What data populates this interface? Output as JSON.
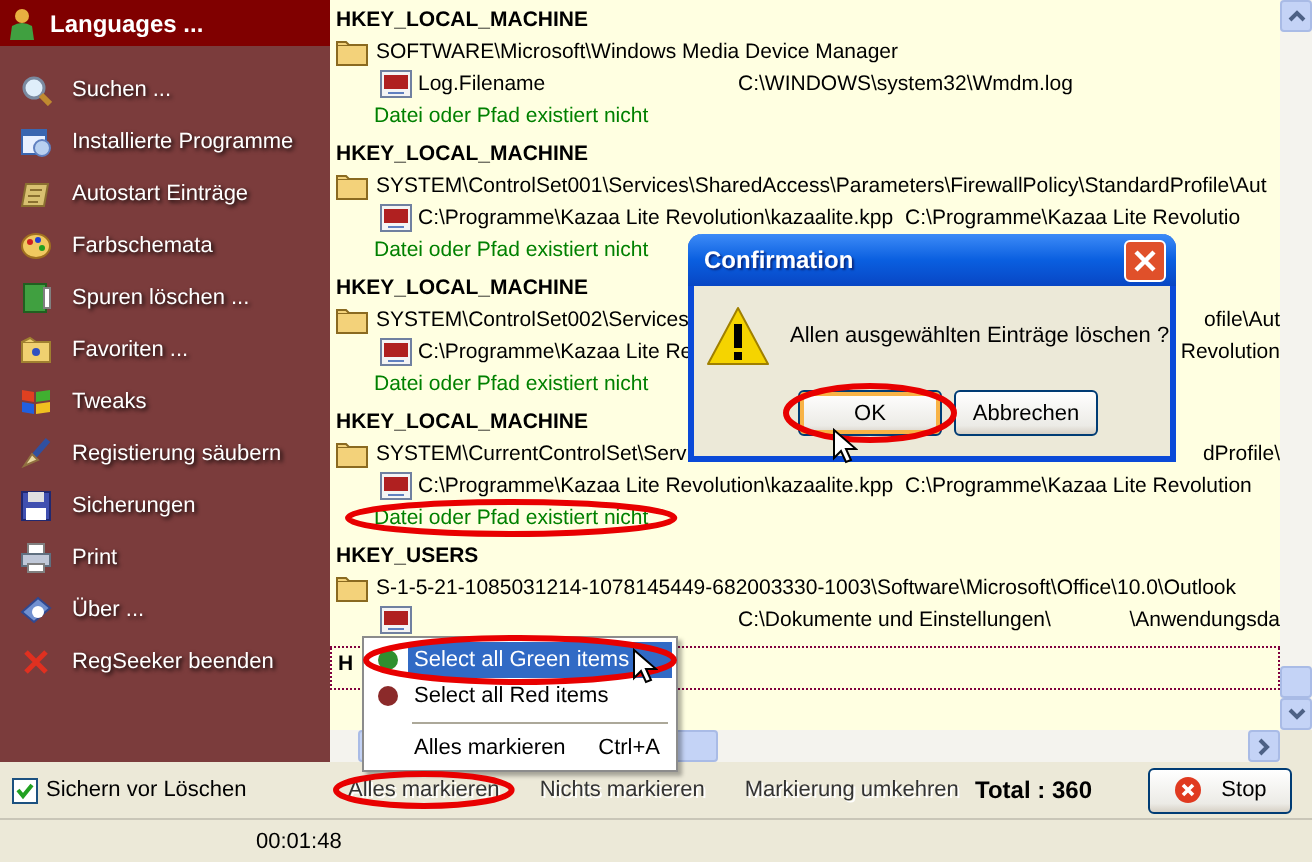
{
  "sidebar": {
    "title": "Languages ...",
    "items": [
      {
        "label": "Suchen ..."
      },
      {
        "label": "Installierte Programme"
      },
      {
        "label": "Autostart Einträge"
      },
      {
        "label": "Farbschemata"
      },
      {
        "label": "Spuren löschen ..."
      },
      {
        "label": "Favoriten ..."
      },
      {
        "label": "Tweaks"
      },
      {
        "label": "Registierung säubern"
      },
      {
        "label": "Sicherungen"
      },
      {
        "label": "Print"
      },
      {
        "label": "Über ..."
      },
      {
        "label": "RegSeeker beenden"
      }
    ]
  },
  "groups": [
    {
      "hive": "HKEY_LOCAL_MACHINE",
      "key_path": {
        "text": "SOFTWARE\\Microsoft\\Windows Media Device Manager"
      },
      "value": {
        "name": "Log.Filename",
        "data": "C:\\WINDOWS\\system32\\Wmdm.log"
      },
      "status": "Datei oder Pfad existiert nicht",
      "status_circled": false
    },
    {
      "hive": "HKEY_LOCAL_MACHINE",
      "key_path": {
        "text": "SYSTEM\\ControlSet001\\Services\\SharedAccess\\Parameters\\FirewallPolicy\\StandardProfile\\Aut"
      },
      "value": {
        "name": "C:\\Programme\\Kazaa Lite Revolution\\kazaalite.kpp",
        "data": "C:\\Programme\\Kazaa Lite Revolutio"
      },
      "status": "Datei oder Pfad existiert nicht",
      "status_circled": false
    },
    {
      "hive": "HKEY_LOCAL_MACHINE",
      "key_path": {
        "text": "SYSTEM\\ControlSet002\\Services",
        "tail": "ofile\\Aut"
      },
      "value": {
        "name": "C:\\Programme\\Kazaa Lite Re",
        "tail": "Revolution"
      },
      "status": "Datei oder Pfad existiert nicht",
      "status_circled": false
    },
    {
      "hive": "HKEY_LOCAL_MACHINE",
      "key_path": {
        "text": "SYSTEM\\CurrentControlSet\\Serv",
        "tail": "dProfile\\"
      },
      "value": {
        "name": "C:\\Programme\\Kazaa Lite Revolution\\kazaalite.kpp",
        "data": "C:\\Programme\\Kazaa Lite Revolution"
      },
      "status": "Datei oder Pfad existiert nicht",
      "status_circled": true
    },
    {
      "hive": "HKEY_USERS",
      "key_path": {
        "text": "S-1-5-21-1085031214-1078145449-682003330-1003\\Software\\Microsoft\\Office\\10.0\\Outlook"
      },
      "value": {
        "data": "C:\\Dokumente und Einstellungen\\",
        "tail": "\\Anwendungsda"
      }
    },
    {
      "hive": "H",
      "focused": true
    }
  ],
  "context_menu": {
    "items": [
      {
        "kind": "dot",
        "label": "Select all Green items",
        "color": "#2f8f2f",
        "selected": true,
        "circled": true
      },
      {
        "kind": "dot",
        "label": "Select all Red items",
        "color": "#8b2a2a",
        "selected": false,
        "circled": false
      },
      {
        "kind": "separator"
      },
      {
        "kind": "plain",
        "label": "Alles markieren",
        "shortcut": "Ctrl+A",
        "selected": false,
        "circled": false
      }
    ]
  },
  "dialog": {
    "title": "Confirmation",
    "message": "Allen ausgewählten Einträge löschen ?",
    "buttons": [
      {
        "label": "OK",
        "focused": true,
        "circled": true
      },
      {
        "label": "Abbrechen",
        "focused": false,
        "circled": false
      }
    ]
  },
  "bottom_bar": {
    "backup_checkbox": {
      "label": "Sichern vor Löschen",
      "checked": true
    },
    "links": [
      {
        "label": "Alles markieren",
        "circled": true
      },
      {
        "label": "Nichts markieren",
        "circled": false
      },
      {
        "label": "Markierung umkehren",
        "circled": false
      }
    ],
    "total": "Total : 360",
    "stop_button": "Stop"
  },
  "status_bar": {
    "time": "00:01:48"
  }
}
